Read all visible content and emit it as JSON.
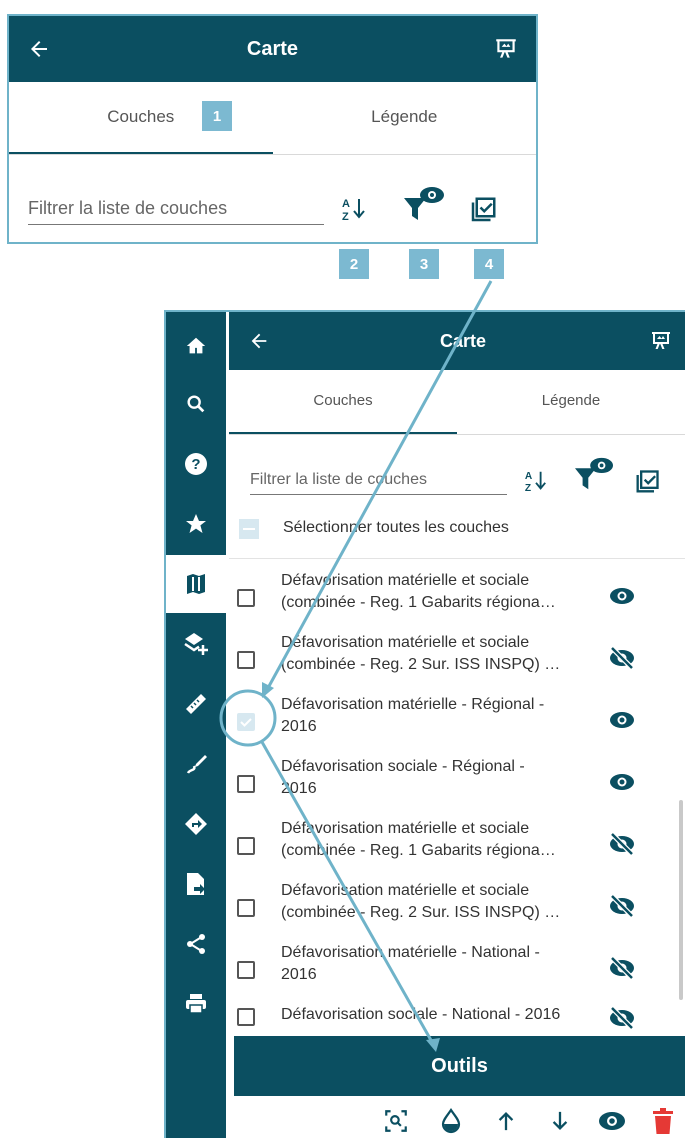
{
  "top_panel": {
    "header": {
      "title": "Carte"
    },
    "tabs": [
      {
        "label": "Couches"
      },
      {
        "label": "Légende"
      }
    ],
    "filter": {
      "placeholder": "Filtrer la liste de couches"
    },
    "badges": [
      "1",
      "2",
      "3",
      "4"
    ]
  },
  "bottom_panel": {
    "header": {
      "title": "Carte"
    },
    "tabs": [
      {
        "label": "Couches"
      },
      {
        "label": "Légende"
      }
    ],
    "filter": {
      "placeholder": "Filtrer la liste de couches"
    },
    "select_all_label": "Sélectionner toutes les couches",
    "sidebar_icons": [
      "home-icon",
      "search-icon",
      "help-icon",
      "star-icon",
      "map-icon",
      "add-layer-icon",
      "ruler-icon",
      "draw-icon",
      "directions-icon",
      "import-file-icon",
      "share-icon",
      "print-icon"
    ],
    "layers": [
      {
        "line1": "Défavorisation matérielle et sociale",
        "line2": "(combinée - Reg. 1 Gabarits régiona…",
        "checked": false,
        "visible": true
      },
      {
        "line1": "Défavorisation matérielle et sociale",
        "line2": "(combinée - Reg. 2 Sur. ISS INSPQ) …",
        "checked": false,
        "visible": false
      },
      {
        "line1": "Défavorisation matérielle - Régional -",
        "line2": "2016",
        "checked": true,
        "visible": true
      },
      {
        "line1": "Défavorisation sociale - Régional -",
        "line2": "2016",
        "checked": false,
        "visible": true
      },
      {
        "line1": "Défavorisation matérielle et sociale",
        "line2": "(combinée - Reg. 1 Gabarits régiona…",
        "checked": false,
        "visible": false
      },
      {
        "line1": "Défavorisation matérielle et sociale",
        "line2": "(combinée - Reg. 2 Sur. ISS INSPQ) …",
        "checked": false,
        "visible": false
      },
      {
        "line1": "Défavorisation matérielle - National -",
        "line2": "2016",
        "checked": false,
        "visible": false
      },
      {
        "line1": "Défavorisation sociale - National - 2016",
        "line2": "",
        "checked": false,
        "visible": false
      }
    ],
    "tools_label": "Outils",
    "tool_icons": [
      "zoom-to-layer-icon",
      "opacity-icon",
      "move-up-icon",
      "move-down-icon",
      "visibility-icon",
      "delete-icon"
    ]
  },
  "colors": {
    "primary": "#0b4f61",
    "badge": "#7cb9d1",
    "annotation": "#6fb3c9",
    "delete": "#e53935"
  }
}
